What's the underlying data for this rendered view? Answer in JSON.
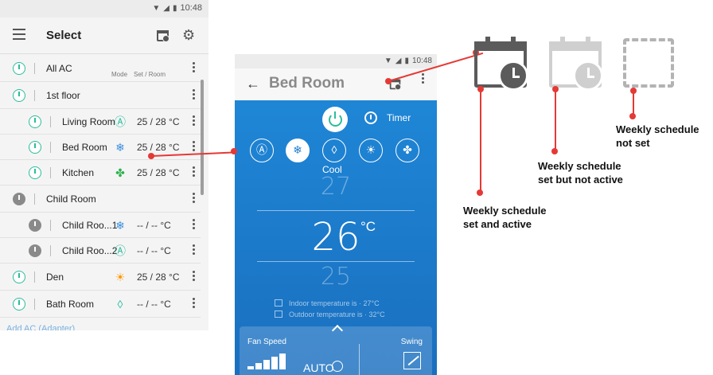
{
  "left_screen": {
    "status_time": "10:48",
    "title": "Select",
    "column_headers": {
      "mode": "Mode",
      "set_room": "Set / Room"
    },
    "rows": [
      {
        "name": "All AC",
        "mode_icon": "",
        "value": "",
        "power": "on",
        "level": 0
      },
      {
        "name": "1st floor",
        "mode_icon": "",
        "value": "",
        "power": "on",
        "level": 0
      },
      {
        "name": "Living Room",
        "mode_icon": "auto-mode-icon",
        "value": "25 / 28 °C",
        "power": "on",
        "level": 1
      },
      {
        "name": "Bed Room",
        "mode_icon": "snowflake-icon",
        "value": "25 / 28 °C",
        "power": "on",
        "level": 1
      },
      {
        "name": "Kitchen",
        "mode_icon": "fan-icon",
        "value": "25 / 28 °C",
        "power": "on",
        "level": 1
      },
      {
        "name": "Child Room",
        "mode_icon": "",
        "value": "",
        "power": "off",
        "level": 0
      },
      {
        "name": "Child Roo...1",
        "mode_icon": "snowflake-icon",
        "value": "-- / --  °C",
        "power": "off",
        "level": 1
      },
      {
        "name": "Child Roo...2",
        "mode_icon": "auto-mode-icon",
        "value": "-- / --  °C",
        "power": "off",
        "level": 1
      },
      {
        "name": "Den",
        "mode_icon": "sun-icon",
        "value": "25 / 28 °C",
        "power": "on",
        "level": 0
      },
      {
        "name": "Bath Room",
        "mode_icon": "drop-icon",
        "value": "-- / --  °C",
        "power": "on",
        "level": 0
      }
    ],
    "add_link": "Add AC (Adapter)"
  },
  "mid_screen": {
    "status_time": "10:48",
    "title": "Bed Room",
    "timer_label": "Timer",
    "mode_label": "Cool",
    "temp_up": "27",
    "temp_current": "26",
    "temp_unit": "°C",
    "temp_down": "25",
    "indoor_text": "Indoor temperature is · 27°C",
    "outdoor_text": "Outdoor temperature is · 32°C",
    "fan_speed_label": "Fan Speed",
    "fan_speed_value": "AUTO",
    "swing_label": "Swing"
  },
  "annotations": {
    "set_active": "Weekly schedule\nset and active",
    "set_inactive": "Weekly schedule\nset but not active",
    "not_set": "Weekly schedule\nnot set"
  },
  "colors": {
    "accent_green": "#2bbd9b",
    "blue": "#1f7fd1",
    "annotation_red": "#e53935",
    "snowflake_blue": "#3b8fe0",
    "fan_green": "#2bb24c",
    "sun_orange": "#ff9800"
  }
}
